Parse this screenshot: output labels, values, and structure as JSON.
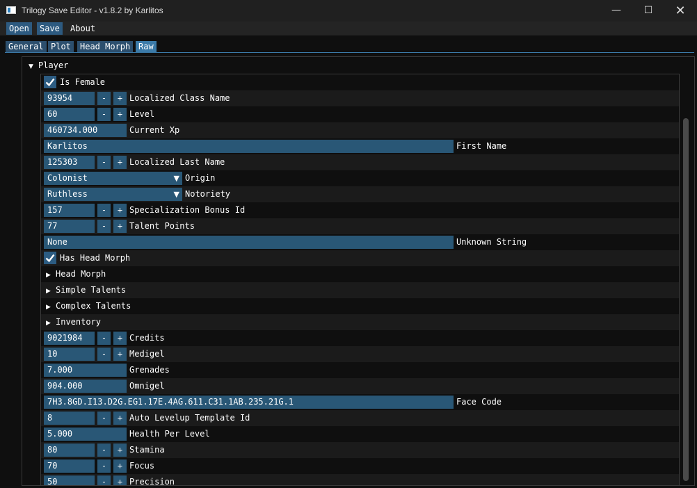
{
  "window": {
    "title": "Trilogy Save Editor - v1.8.2 by Karlitos"
  },
  "menu": {
    "open": "Open",
    "save": "Save",
    "about": "About"
  },
  "tabs": {
    "general": "General",
    "plot": "Plot",
    "head_morph": "Head Morph",
    "raw": "Raw"
  },
  "player": {
    "header": "Player",
    "is_female_label": "Is Female",
    "is_female": true,
    "localized_class_name": {
      "value": "93954",
      "label": "Localized Class Name"
    },
    "level": {
      "value": "60",
      "label": "Level"
    },
    "current_xp": {
      "value": "460734.000",
      "label": "Current Xp"
    },
    "first_name": {
      "value": "Karlitos",
      "label": "First Name"
    },
    "localized_last_name": {
      "value": "125303",
      "label": "Localized Last Name"
    },
    "origin": {
      "value": "Colonist",
      "label": "Origin"
    },
    "notoriety": {
      "value": "Ruthless",
      "label": "Notoriety"
    },
    "specialization_bonus_id": {
      "value": "157",
      "label": "Specialization Bonus Id"
    },
    "talent_points": {
      "value": "77",
      "label": "Talent Points"
    },
    "unknown_string": {
      "value": "None",
      "label": "Unknown String"
    },
    "has_head_morph_label": "Has Head Morph",
    "has_head_morph": true,
    "head_morph_tree": "Head Morph",
    "simple_talents_tree": "Simple Talents",
    "complex_talents_tree": "Complex Talents",
    "inventory_tree": "Inventory",
    "credits": {
      "value": "9021984",
      "label": "Credits"
    },
    "medigel": {
      "value": "10",
      "label": "Medigel"
    },
    "grenades": {
      "value": "7.000",
      "label": "Grenades"
    },
    "omnigel": {
      "value": "904.000",
      "label": "Omnigel"
    },
    "face_code": {
      "value": "7H3.8GD.I13.D2G.EG1.17E.4AG.611.C31.1AB.235.21G.1",
      "label": "Face Code"
    },
    "auto_levelup_template_id": {
      "value": "8",
      "label": "Auto Levelup Template Id"
    },
    "health_per_level": {
      "value": "5.000",
      "label": "Health Per Level"
    },
    "stamina": {
      "value": "80",
      "label": "Stamina"
    },
    "focus": {
      "value": "70",
      "label": "Focus"
    },
    "precision": {
      "value": "50",
      "label": "Precision"
    }
  },
  "stepper": {
    "minus": "-",
    "plus": "+"
  },
  "icons": {
    "expanded": "caret-down-icon",
    "collapsed": "caret-right-icon",
    "check": "check-icon",
    "dropdown": "triangle-down-icon"
  },
  "colors": {
    "accent": "#295776",
    "tab_active": "#3b7aa8",
    "alt_row": "#1b1b1b"
  }
}
